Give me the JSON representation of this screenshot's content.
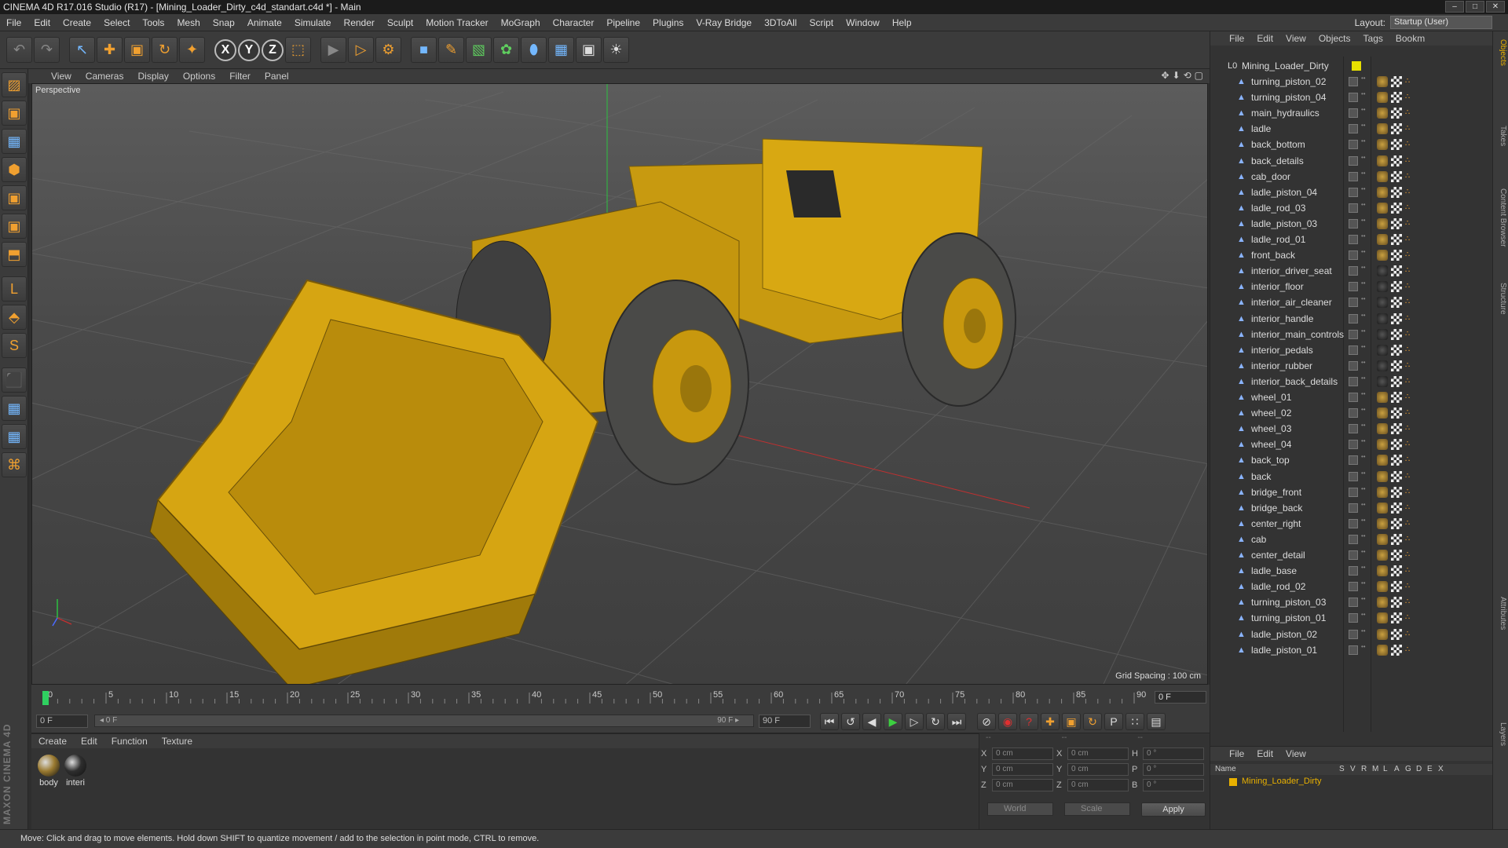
{
  "window": {
    "title": "CINEMA 4D R17.016 Studio (R17) - [Mining_Loader_Dirty_c4d_standart.c4d *] - Main",
    "buttons": [
      "–",
      "□",
      "✕"
    ]
  },
  "menubar": {
    "items": [
      "File",
      "Edit",
      "Create",
      "Select",
      "Tools",
      "Mesh",
      "Snap",
      "Animate",
      "Simulate",
      "Render",
      "Sculpt",
      "Motion Tracker",
      "MoGraph",
      "Character",
      "Pipeline",
      "Plugins",
      "V-Ray Bridge",
      "3DToAll",
      "Script",
      "Window",
      "Help"
    ],
    "layout_label": "Layout:",
    "layout_value": "Startup (User)"
  },
  "toolbar": {
    "undo": "↶",
    "redo": "↷",
    "select": "↖",
    "move": "✚",
    "scale": "▣",
    "rotate": "↻",
    "transform": "✦",
    "x_axis": "X",
    "y_axis": "Y",
    "z_axis": "Z",
    "coord": "⬚",
    "render_view": "▶",
    "render_pv": "▷",
    "render_settings": "⚙",
    "cube": "■",
    "pen": "✎",
    "subdiv": "▧",
    "array": "✿",
    "deformer": "⬮",
    "floor": "▦",
    "camera": "▣",
    "light": "☀"
  },
  "lefttools": [
    "▨",
    "▣",
    "▦",
    "⬢",
    "▣",
    "▣",
    "⬒",
    "L",
    "⬘",
    "S",
    "⬛",
    "▦",
    "▦",
    "⌘"
  ],
  "branding": "MAXON CINEMA 4D",
  "viewport": {
    "menu": [
      "View",
      "Cameras",
      "Display",
      "Options",
      "Filter",
      "Panel"
    ],
    "icons": [
      "✥",
      "⬇",
      "⟲",
      "▢"
    ],
    "label": "Perspective",
    "grid_spacing": "Grid Spacing : 100 cm"
  },
  "timeline": {
    "ticks": [
      "0",
      "5",
      "10",
      "15",
      "20",
      "25",
      "30",
      "35",
      "40",
      "45",
      "50",
      "55",
      "60",
      "65",
      "70",
      "75",
      "80",
      "85",
      "90"
    ],
    "frame_end": "0 F"
  },
  "transport": {
    "current_frame": "0 F",
    "range_start": "◂ 0 F",
    "range_end": "90 F ▸",
    "end_frame": "90 F",
    "buttons": [
      "⏮",
      "↺",
      "◀",
      "▶",
      "▷",
      "↻",
      "⏭"
    ],
    "key_buttons": [
      "⊘",
      "◉",
      "?",
      "✚",
      "▣",
      "↻",
      "P",
      "∷",
      "▤"
    ]
  },
  "materials": {
    "menu": [
      "Create",
      "Edit",
      "Function",
      "Texture"
    ],
    "items": [
      {
        "name": "body",
        "color": "#9a7a30"
      },
      {
        "name": "interi",
        "color": "#2e2e2e"
      }
    ]
  },
  "coords": {
    "head": [
      "--",
      "--",
      "--"
    ],
    "rows": [
      {
        "l1": "X",
        "v1": "0 cm",
        "l2": "X",
        "v2": "0 cm",
        "l3": "H",
        "v3": "0 °"
      },
      {
        "l1": "Y",
        "v1": "0 cm",
        "l2": "Y",
        "v2": "0 cm",
        "l3": "P",
        "v3": "0 °"
      },
      {
        "l1": "Z",
        "v1": "0 cm",
        "l2": "Z",
        "v2": "0 cm",
        "l3": "B",
        "v3": "0 °"
      }
    ],
    "mode_world": "World",
    "mode_scale": "Scale",
    "apply": "Apply"
  },
  "objects": {
    "menu": [
      "File",
      "Edit",
      "View",
      "Objects",
      "Tags",
      "Bookm"
    ],
    "root": "Mining_Loader_Dirty",
    "items": [
      {
        "name": "turning_piston_02",
        "dark": false
      },
      {
        "name": "turning_piston_04",
        "dark": false
      },
      {
        "name": "main_hydraulics",
        "dark": false
      },
      {
        "name": "ladle",
        "dark": false
      },
      {
        "name": "back_bottom",
        "dark": false
      },
      {
        "name": "back_details",
        "dark": false
      },
      {
        "name": "cab_door",
        "dark": false
      },
      {
        "name": "ladle_piston_04",
        "dark": false
      },
      {
        "name": "ladle_rod_03",
        "dark": false
      },
      {
        "name": "ladle_piston_03",
        "dark": false
      },
      {
        "name": "ladle_rod_01",
        "dark": false
      },
      {
        "name": "front_back",
        "dark": false
      },
      {
        "name": "interior_driver_seat",
        "dark": true
      },
      {
        "name": "interior_floor",
        "dark": true
      },
      {
        "name": "interior_air_cleaner",
        "dark": true
      },
      {
        "name": "interior_handle",
        "dark": true
      },
      {
        "name": "interior_main_controls",
        "dark": true
      },
      {
        "name": "interior_pedals",
        "dark": true
      },
      {
        "name": "interior_rubber",
        "dark": true
      },
      {
        "name": "interior_back_details",
        "dark": true
      },
      {
        "name": "wheel_01",
        "dark": false
      },
      {
        "name": "wheel_02",
        "dark": false
      },
      {
        "name": "wheel_03",
        "dark": false
      },
      {
        "name": "wheel_04",
        "dark": false
      },
      {
        "name": "back_top",
        "dark": false
      },
      {
        "name": "back",
        "dark": false
      },
      {
        "name": "bridge_front",
        "dark": false
      },
      {
        "name": "bridge_back",
        "dark": false
      },
      {
        "name": "center_right",
        "dark": false
      },
      {
        "name": "cab",
        "dark": false
      },
      {
        "name": "center_detail",
        "dark": false
      },
      {
        "name": "ladle_base",
        "dark": false
      },
      {
        "name": "ladle_rod_02",
        "dark": false
      },
      {
        "name": "turning_piston_03",
        "dark": false
      },
      {
        "name": "turning_piston_01",
        "dark": false
      },
      {
        "name": "ladle_piston_02",
        "dark": false
      },
      {
        "name": "ladle_piston_01",
        "dark": false
      }
    ]
  },
  "layers": {
    "menu": [
      "File",
      "Edit",
      "View"
    ],
    "columns": [
      "Name",
      "S",
      "V",
      "R",
      "M",
      "L",
      "A",
      "G",
      "D",
      "E",
      "X"
    ],
    "row": "Mining_Loader_Dirty",
    "row_color": "#e8b000"
  },
  "sidetabs": [
    "Objects",
    "Takes",
    "Content Browser",
    "Structure",
    "Attributes",
    "Layers"
  ],
  "status": "Move: Click and drag to move elements. Hold down SHIFT to quantize movement / add to the selection in point mode, CTRL to remove.",
  "colors": {
    "accent": "#f0a030",
    "loader": "#d4a20c",
    "timeline_marker": "#2fd060"
  }
}
